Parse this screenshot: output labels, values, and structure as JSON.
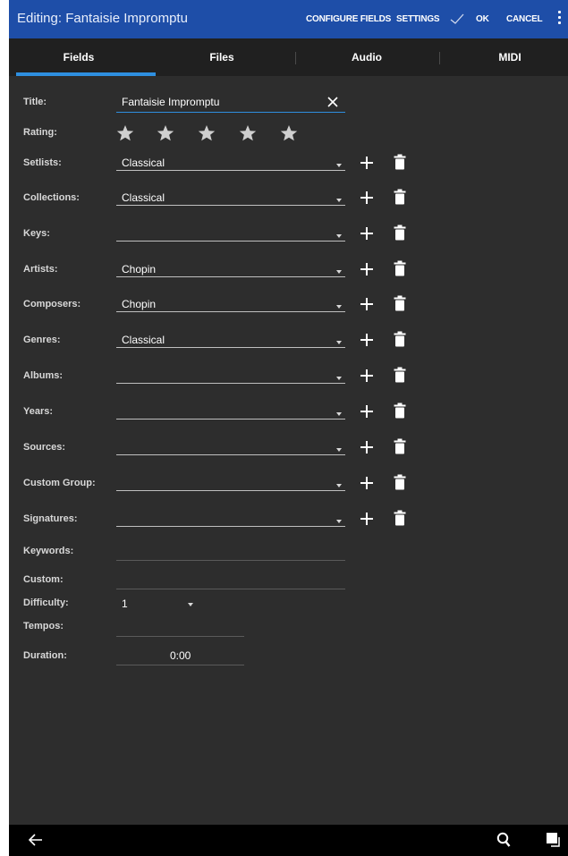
{
  "actionbar": {
    "title": "Editing: Fantaisie Impromptu",
    "configure_fields": "CONFIGURE FIELDS",
    "settings": "SETTINGS",
    "ok": "OK",
    "cancel": "CANCEL",
    "icons": [
      "check-icon",
      "overflow-menu-icon"
    ]
  },
  "tabs": [
    {
      "label": "Fields",
      "selected": true
    },
    {
      "label": "Files",
      "selected": false
    },
    {
      "label": "Audio",
      "selected": false
    },
    {
      "label": "MIDI",
      "selected": false
    }
  ],
  "form": {
    "title": {
      "label": "Title:",
      "value": "Fantaisie Impromptu"
    },
    "rating": {
      "label": "Rating:",
      "stars_total": 5,
      "stars_filled": 0
    },
    "setlists": {
      "label": "Setlists:",
      "value": "Classical"
    },
    "collections": {
      "label": "Collections:",
      "value": "Classical"
    },
    "keys": {
      "label": "Keys:",
      "value": ""
    },
    "artists": {
      "label": "Artists:",
      "value": "Chopin"
    },
    "composers": {
      "label": "Composers:",
      "value": "Chopin"
    },
    "genres": {
      "label": "Genres:",
      "value": "Classical"
    },
    "albums": {
      "label": "Albums:",
      "value": ""
    },
    "years": {
      "label": "Years:",
      "value": ""
    },
    "sources": {
      "label": "Sources:",
      "value": ""
    },
    "custom_group": {
      "label": "Custom Group:",
      "value": ""
    },
    "signatures": {
      "label": "Signatures:",
      "value": ""
    },
    "keywords": {
      "label": "Keywords:",
      "value": ""
    },
    "custom": {
      "label": "Custom:",
      "value": ""
    },
    "difficulty": {
      "label": "Difficulty:",
      "value": "1"
    },
    "tempos": {
      "label": "Tempos:",
      "value": ""
    },
    "duration": {
      "label": "Duration:",
      "value": "0:00"
    }
  },
  "navbar": {
    "icons": [
      "back-arrow-icon",
      "search-icon",
      "recent-apps-icon"
    ]
  },
  "colors": {
    "actionbar": "#1e4ea8",
    "tab_indicator": "#2e8fe0",
    "background": "#2d2d2d",
    "tabbar": "#202020",
    "title_underline": "#2e8fe0"
  }
}
